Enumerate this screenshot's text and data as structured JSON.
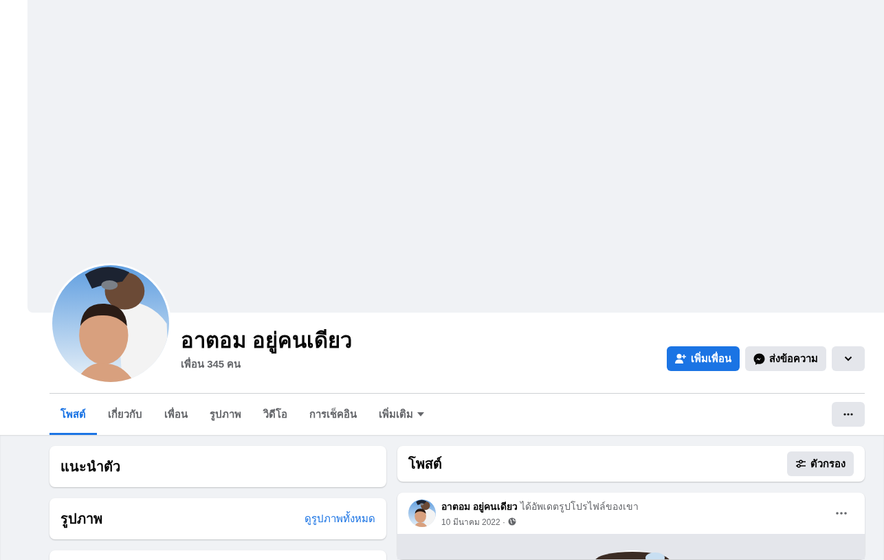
{
  "profile": {
    "name": "อาตอม อยู่คนเดียว",
    "friends": "เพื่อน 345 คน"
  },
  "actions": [
    {
      "kind": "add-friend",
      "label": "เพิ่มเพื่อน"
    },
    {
      "kind": "message",
      "label": "ส่งข้อความ"
    },
    {
      "kind": "dropdown"
    }
  ],
  "tabs": [
    {
      "label": "โพสต์",
      "selected": true,
      "kind": "tab"
    },
    {
      "label": "เกี่ยวกับ",
      "selected": false,
      "kind": "tab"
    },
    {
      "label": "เพื่อน",
      "selected": false,
      "kind": "tab"
    },
    {
      "label": "รูปภาพ",
      "selected": false,
      "kind": "tab"
    },
    {
      "label": "วิดีโอ",
      "selected": false,
      "kind": "tab"
    },
    {
      "label": "การเช็คอิน",
      "selected": false,
      "kind": "tab"
    },
    {
      "label": "เพิ่มเติม",
      "selected": false,
      "kind": "menu"
    }
  ],
  "sidebar": [
    {
      "kind": "card",
      "title": "แนะนำตัว"
    },
    {
      "kind": "card",
      "title": "รูปภาพ",
      "link": "ดูรูปภาพทั้งหมด"
    },
    {
      "kind": "card"
    }
  ],
  "posts_header": {
    "title": "โพสต์",
    "filter": "ตัวกรอง"
  },
  "post": {
    "author": "อาตอม อยู่คนเดียว",
    "action": "ได้อัพเดตรูปโปรไฟล์ของเขา",
    "date": "10 มีนาคม 2022 ·"
  }
}
